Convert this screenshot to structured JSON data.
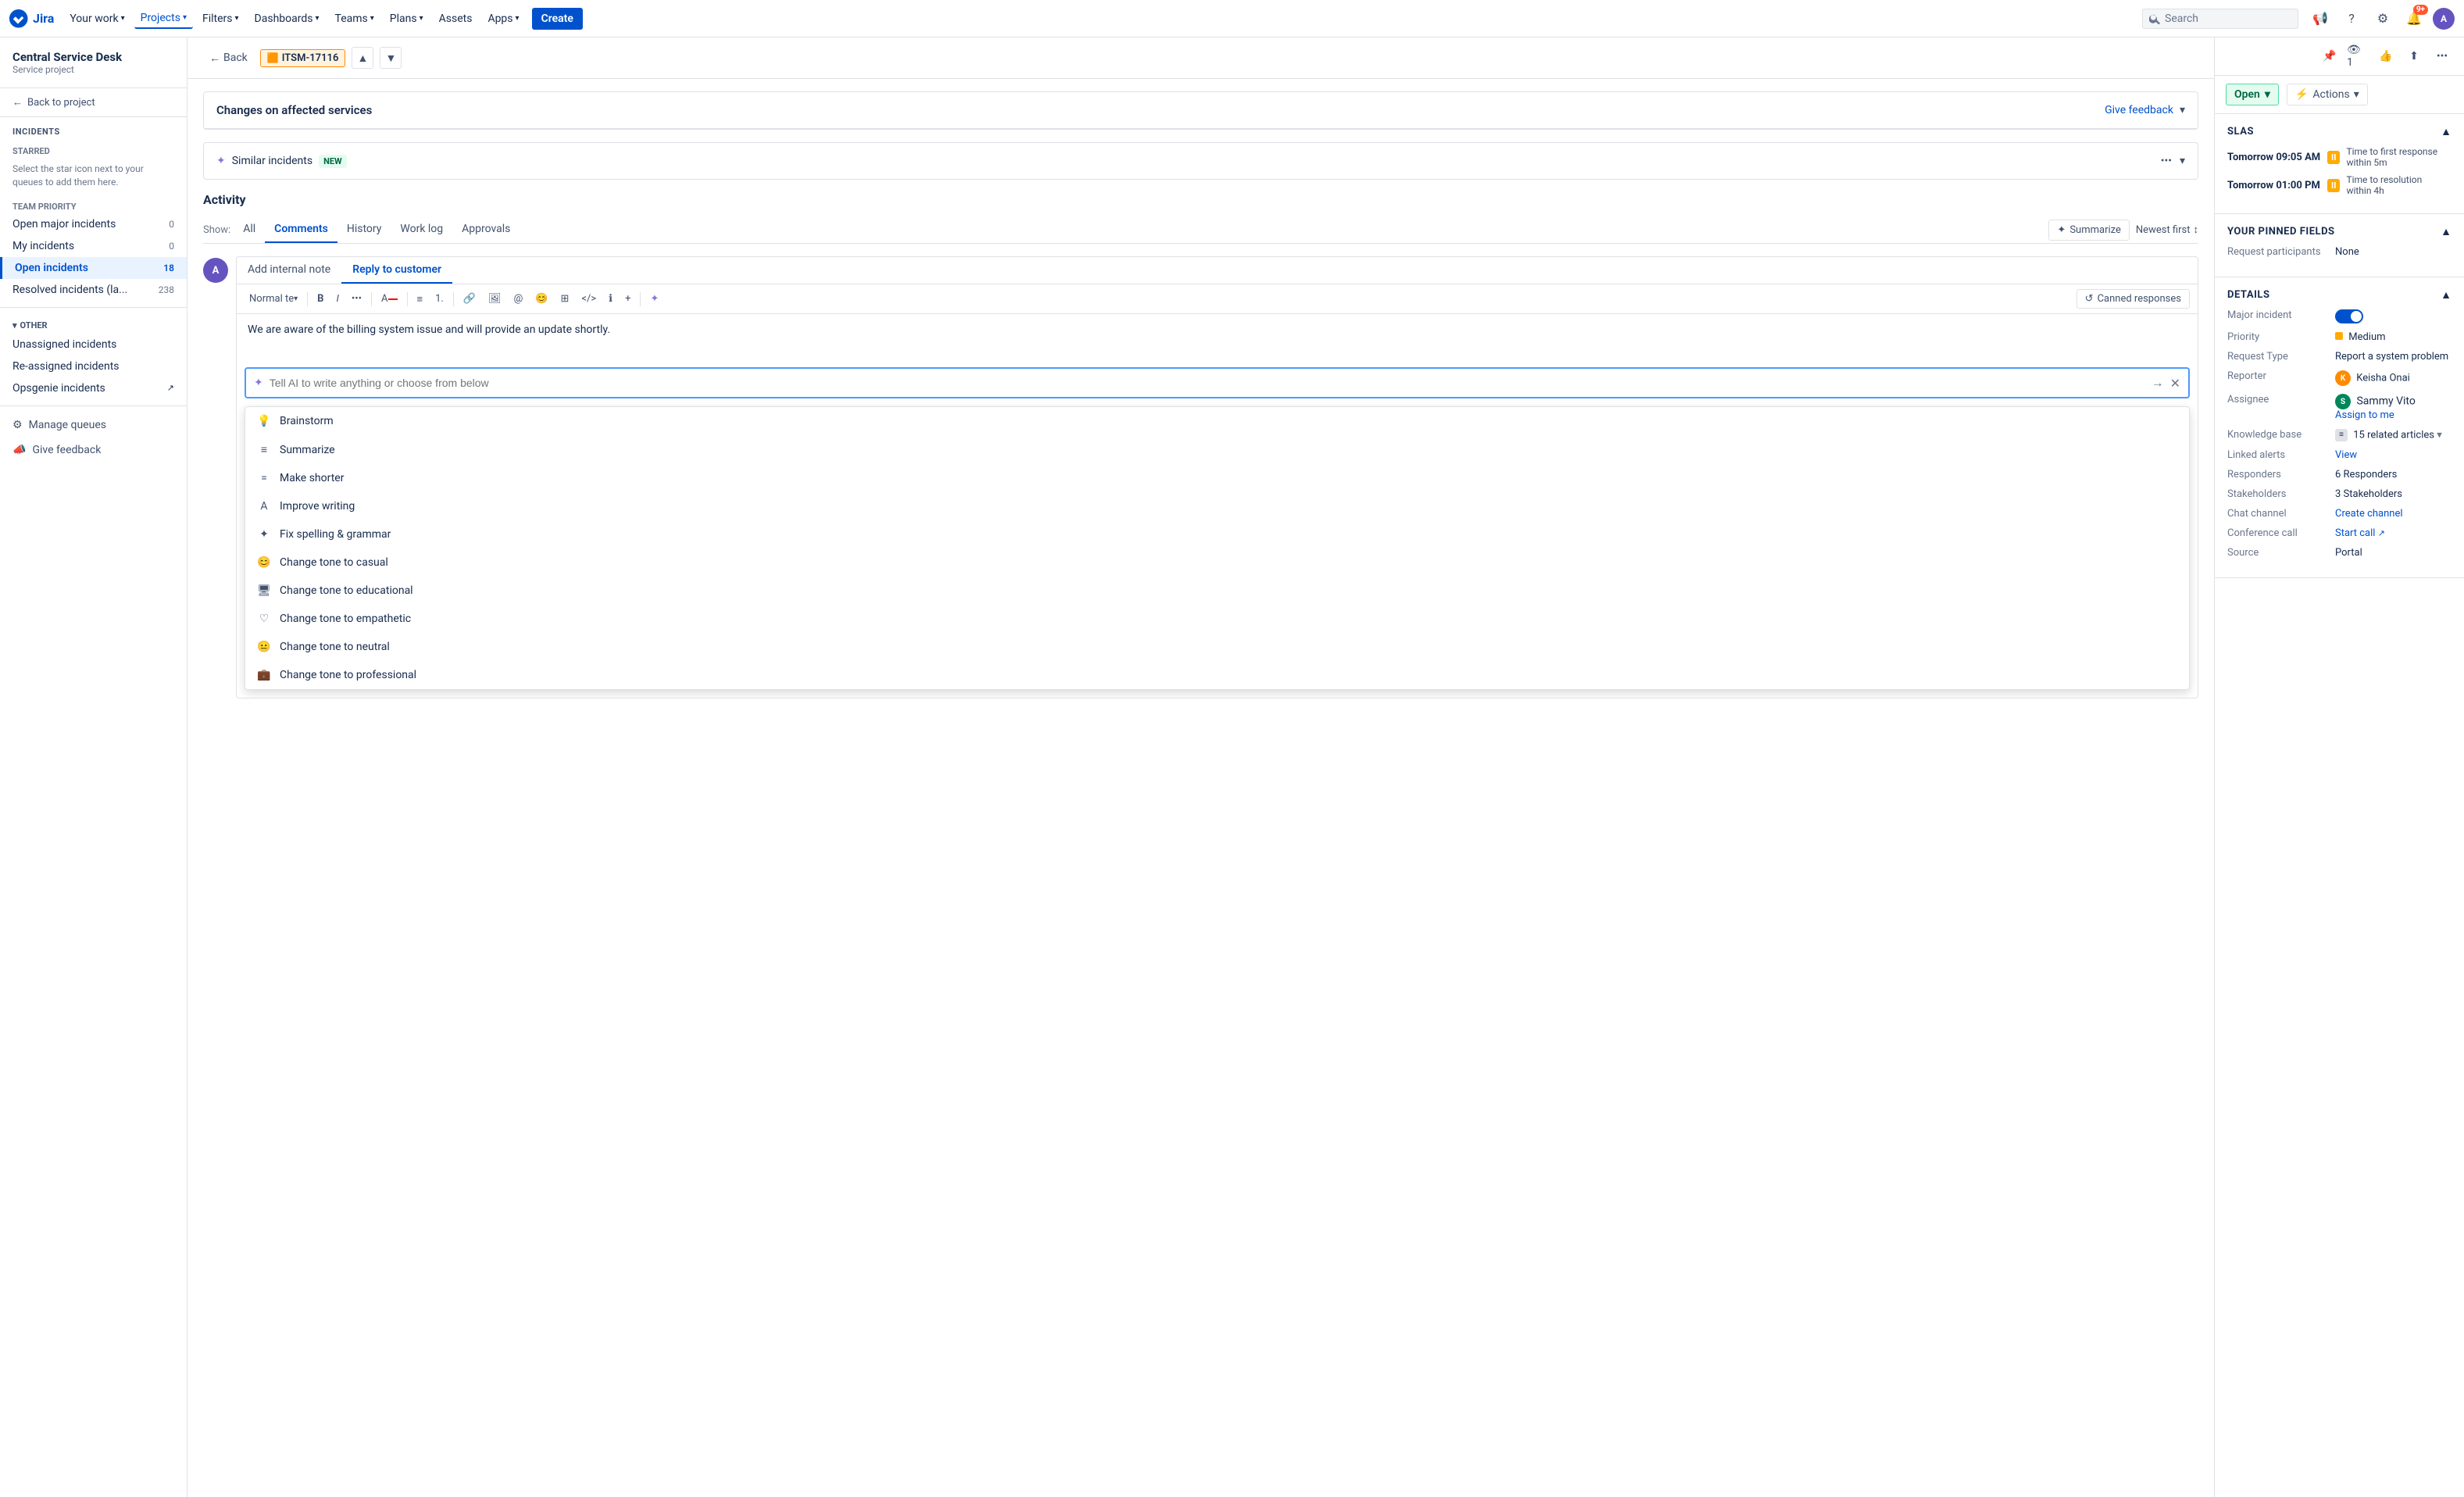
{
  "topNav": {
    "logo": "Jira",
    "items": [
      {
        "label": "Your work",
        "hasDropdown": true
      },
      {
        "label": "Projects",
        "hasDropdown": true,
        "active": true
      },
      {
        "label": "Filters",
        "hasDropdown": true
      },
      {
        "label": "Dashboards",
        "hasDropdown": true
      },
      {
        "label": "Teams",
        "hasDropdown": true
      },
      {
        "label": "Plans",
        "hasDropdown": true
      },
      {
        "label": "Assets",
        "hasDropdown": false
      },
      {
        "label": "Apps",
        "hasDropdown": true
      }
    ],
    "createLabel": "Create",
    "searchPlaceholder": "Search",
    "notificationCount": "9+"
  },
  "sidebar": {
    "projectName": "Central Service Desk",
    "projectType": "Service project",
    "backLabel": "Back to project",
    "sectionTitle": "Incidents",
    "starredLabel": "STARRED",
    "starredMsg": "Select the star icon next to your queues to add them here.",
    "teamPriority": "TEAM PRIORITY",
    "teamItems": [
      {
        "label": "Open major incidents",
        "count": "0"
      },
      {
        "label": "My incidents",
        "count": "0"
      },
      {
        "label": "Open incidents",
        "count": "18",
        "active": true
      },
      {
        "label": "Resolved incidents (la...",
        "count": "238"
      }
    ],
    "otherLabel": "OTHER",
    "otherItems": [
      {
        "label": "Unassigned incidents"
      },
      {
        "label": "Re-assigned incidents"
      },
      {
        "label": "Opsgenie incidents",
        "external": true
      }
    ],
    "manageQueues": "Manage queues",
    "giveFeedback": "Give feedback"
  },
  "issueHeader": {
    "backLabel": "Back",
    "issueId": "ITSM-17116"
  },
  "affectedServices": {
    "title": "Changes on affected services",
    "feedbackLabel": "Give feedback"
  },
  "similarIncidents": {
    "label": "Similar incidents",
    "badge": "NEW"
  },
  "activity": {
    "title": "Activity",
    "showLabel": "Show:",
    "tabs": [
      {
        "label": "All"
      },
      {
        "label": "Comments",
        "active": true
      },
      {
        "label": "History"
      },
      {
        "label": "Work log"
      },
      {
        "label": "Approvals"
      }
    ],
    "summarizeLabel": "Summarize",
    "newestLabel": "Newest first"
  },
  "commentBox": {
    "addInternalNote": "Add internal note",
    "replyToCustomer": "Reply to customer",
    "activeTab": "Reply to customer",
    "textContent": "We are aware of the billing system issue and will provide an update shortly.",
    "aiPlaceholder": "Tell AI to write anything or choose from below",
    "cannedResponsesLabel": "Canned responses"
  },
  "aiDropdown": {
    "items": [
      {
        "label": "Brainstorm",
        "icon": "💡"
      },
      {
        "label": "Summarize",
        "icon": "≡"
      },
      {
        "label": "Make shorter",
        "icon": "="
      },
      {
        "label": "Improve writing",
        "icon": "A"
      },
      {
        "label": "Fix spelling & grammar",
        "icon": "✦"
      },
      {
        "label": "Change tone to casual",
        "icon": "😊"
      },
      {
        "label": "Change tone to educational",
        "icon": "🖥"
      },
      {
        "label": "Change tone to empathetic",
        "icon": "♡"
      },
      {
        "label": "Change tone to neutral",
        "icon": "😐"
      },
      {
        "label": "Change tone to professional",
        "icon": "💼"
      }
    ]
  },
  "rightPanel": {
    "statusLabel": "Open",
    "actionsLabel": "Actions",
    "slaTitle": "SLAs",
    "slaItems": [
      {
        "time": "Tomorrow 09:05 AM",
        "paused": true,
        "label": "Time to first response",
        "sublabel": "within 5m"
      },
      {
        "time": "Tomorrow 01:00 PM",
        "paused": true,
        "label": "Time to resolution",
        "sublabel": "within 4h"
      }
    ],
    "pinnedTitle": "Your pinned fields",
    "requestParticipants": {
      "label": "Request participants",
      "value": "None"
    },
    "detailsTitle": "Details",
    "majorIncident": {
      "label": "Major incident",
      "value": "toggle-on"
    },
    "priority": {
      "label": "Priority",
      "value": "Medium"
    },
    "requestType": {
      "label": "Request Type",
      "value": "Report a system problem"
    },
    "reporter": {
      "label": "Reporter",
      "value": "Keisha Onai"
    },
    "assignee": {
      "label": "Assignee",
      "value": "Sammy Vito",
      "action": "Assign to me"
    },
    "knowledgeBase": {
      "label": "Knowledge base",
      "value": "15 related articles"
    },
    "linkedAlerts": {
      "label": "Linked alerts",
      "value": "View"
    },
    "responders": {
      "label": "Responders",
      "value": "6 Responders"
    },
    "stakeholders": {
      "label": "Stakeholders",
      "value": "3 Stakeholders"
    },
    "chatChannel": {
      "label": "Chat channel",
      "value": "Create channel"
    },
    "conferenceCall": {
      "label": "Conference call",
      "value": "Start call"
    },
    "source": {
      "label": "Source",
      "value": "Portal"
    }
  }
}
